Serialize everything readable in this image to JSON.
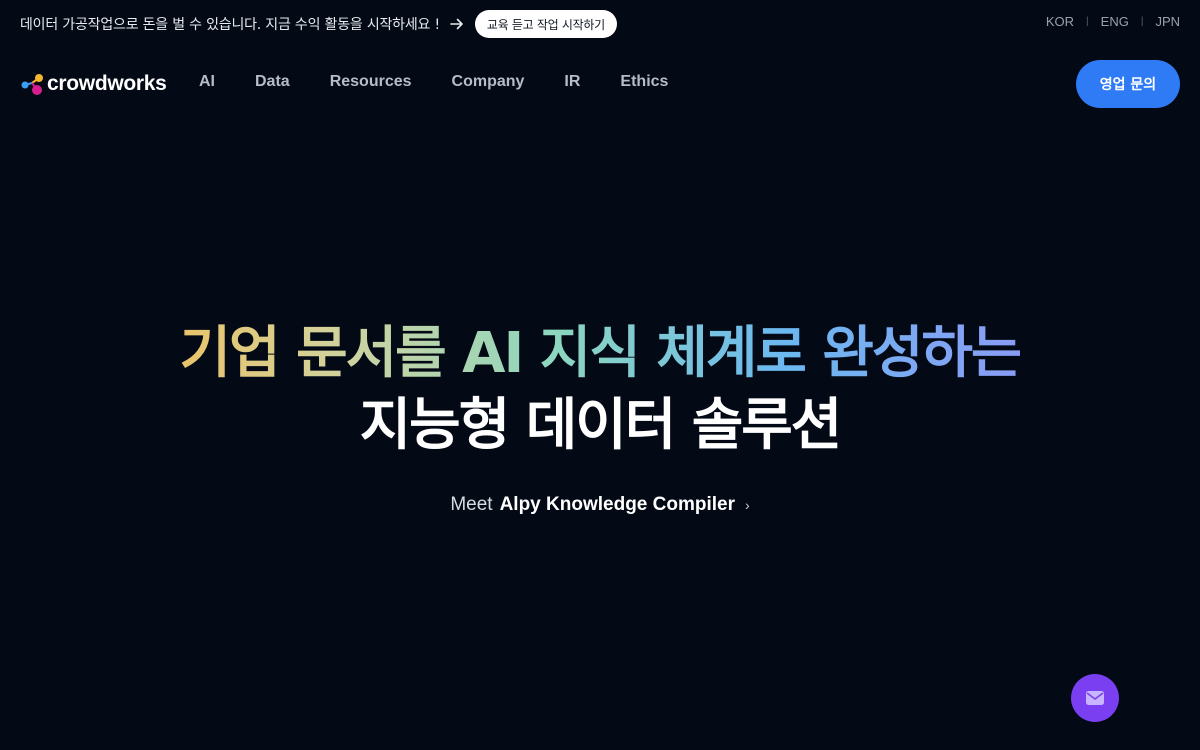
{
  "promo": {
    "text": "데이터 가공작업으로 돈을 벌 수 있습니다.  지금 수익 활동을 시작하세요 !",
    "button_label": "교육 듣고 작업 시작하기"
  },
  "languages": [
    "KOR",
    "ENG",
    "JPN"
  ],
  "brand": {
    "name": "crowdworks",
    "accent_colors": [
      "#f5b82e",
      "#3aa0f5",
      "#d61f8c"
    ]
  },
  "nav": {
    "items": [
      "AI",
      "Data",
      "Resources",
      "Company",
      "IR",
      "Ethics"
    ],
    "cta_label": "영업 문의"
  },
  "hero": {
    "headline_line1": "기업 문서를 AI 지식 체계로 완성하는",
    "headline_line2": "지능형 데이터 솔루션",
    "link_prefix": "Meet",
    "link_product": "Alpy Knowledge Compiler",
    "link_chevron": "›"
  },
  "colors": {
    "background": "#030915",
    "cta": "#2f7bf5",
    "fab": "#7b3ff2"
  },
  "icons": {
    "promo_arrow": "arrow-right-icon",
    "fab": "mail-icon"
  }
}
